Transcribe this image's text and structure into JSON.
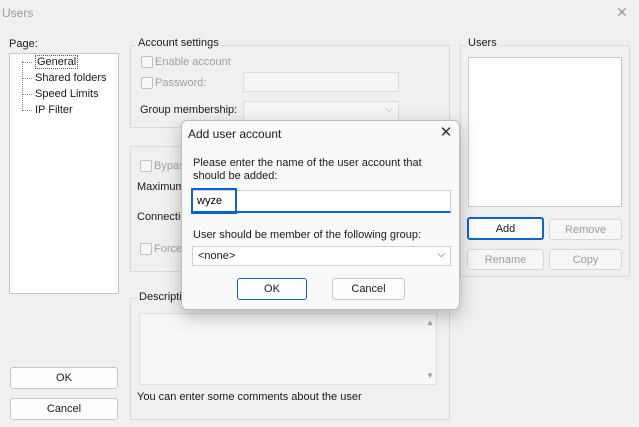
{
  "window": {
    "title": "Users",
    "close_glyph": "✕"
  },
  "page_panel": {
    "label": "Page:",
    "items": [
      "General",
      "Shared folders",
      "Speed Limits",
      "IP Filter"
    ],
    "selected": "General"
  },
  "account_settings": {
    "label": "Account settings",
    "enable_account": "Enable account",
    "password": "Password:",
    "group_membership": "Group membership:"
  },
  "middle_partial": {
    "bypass": "Bypas",
    "maximum": "Maximum",
    "connection": "Connectio",
    "force": "Force"
  },
  "description": {
    "label": "Descriptio",
    "hint": "You can enter some comments about the user"
  },
  "users_panel": {
    "label": "Users",
    "add": "Add",
    "remove": "Remove",
    "rename": "Rename",
    "copy": "Copy"
  },
  "main_buttons": {
    "ok": "OK",
    "cancel": "Cancel"
  },
  "dialog": {
    "title": "Add user account",
    "close_glyph": "✕",
    "prompt": "Please enter the name of the user account that should be added:",
    "username_value": "wyze",
    "group_label": "User should be member of the following group:",
    "group_selected": "<none>",
    "ok": "OK",
    "cancel": "Cancel"
  },
  "colors": {
    "accent": "#0a64d4",
    "background": "#f0f0f0"
  }
}
